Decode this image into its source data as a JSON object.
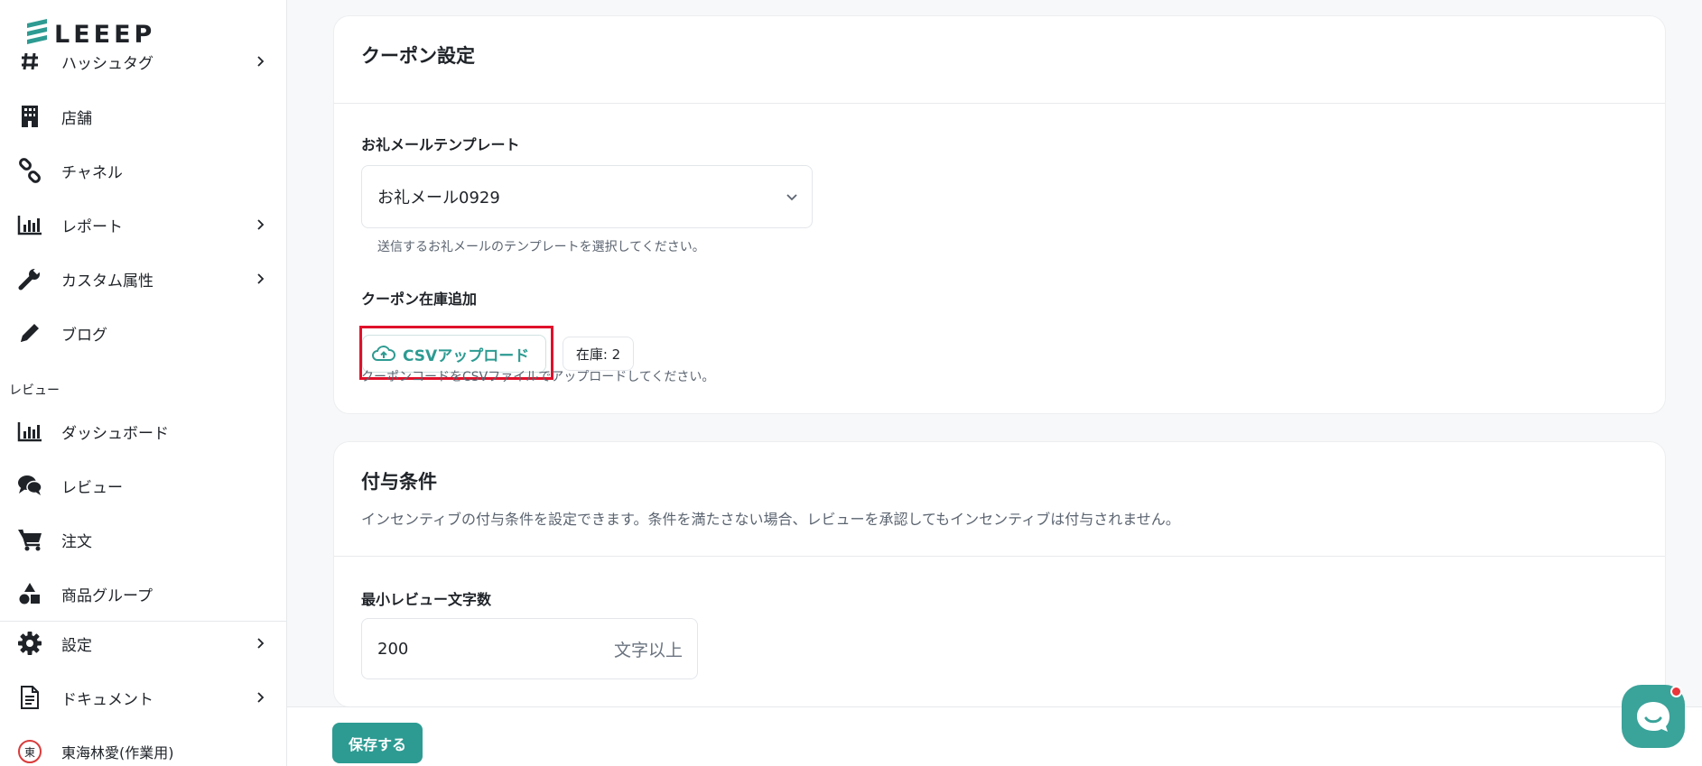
{
  "brand": {
    "name": "LEEEP",
    "accent_color": "#2d9b92",
    "highlight_color": "#e0112b"
  },
  "sidebar": {
    "partial_top_label": "ハッシュタグ",
    "items_top": [
      {
        "label": "店舗",
        "icon": "building-icon"
      },
      {
        "label": "チャネル",
        "icon": "link-icon"
      },
      {
        "label": "レポート",
        "icon": "bar-chart-icon",
        "has_chevron": true
      },
      {
        "label": "カスタム属性",
        "icon": "wrench-icon",
        "has_chevron": true
      },
      {
        "label": "ブログ",
        "icon": "pencil-icon"
      }
    ],
    "section_review": "レビュー",
    "items_review": [
      {
        "label": "ダッシュボード",
        "icon": "bar-chart-icon"
      },
      {
        "label": "レビュー",
        "icon": "chat-bubbles-icon"
      },
      {
        "label": "注文",
        "icon": "cart-icon"
      },
      {
        "label": "商品グループ",
        "icon": "shapes-icon"
      }
    ],
    "items_bottom": [
      {
        "label": "設定",
        "icon": "gear-icon",
        "has_chevron": true
      },
      {
        "label": "ドキュメント",
        "icon": "document-icon",
        "has_chevron": true
      }
    ],
    "user": {
      "avatar_char": "東",
      "name": "東海林愛(作業用)"
    }
  },
  "coupon_card": {
    "title": "クーポン設定",
    "template_label": "お礼メールテンプレート",
    "template_value": "お礼メール0929",
    "template_help": "送信するお礼メールのテンプレートを選択してください。",
    "stock_label": "クーポン在庫追加",
    "csv_button": "CSVアップロード",
    "stock_badge": "在庫: 2",
    "csv_help": "クーポンコードをCSVファイルでアップロードしてください。"
  },
  "condition_card": {
    "title": "付与条件",
    "description": "インセンティブの付与条件を設定できます。条件を満たさない場合、レビューを承認してもインセンティブは付与されません。",
    "min_chars_label": "最小レビュー文字数",
    "min_chars_value": "200",
    "min_chars_suffix": "文字以上"
  },
  "footer": {
    "save_button": "保存する"
  },
  "chat": {
    "icon": "chat-launcher-icon",
    "has_notification": true
  }
}
